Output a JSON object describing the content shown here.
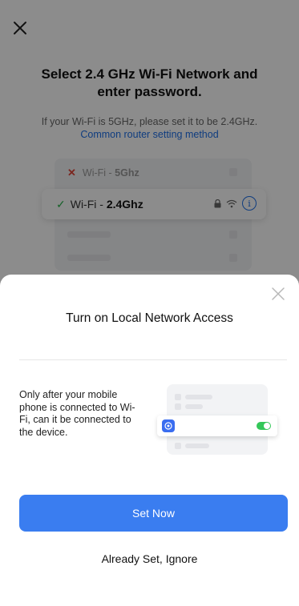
{
  "background": {
    "title": "Select 2.4 GHz Wi-Fi Network and enter password.",
    "hint": "If your Wi-Fi is 5GHz, please set it to be 2.4GHz.",
    "hint_link": "Common router setting method",
    "network_5g": {
      "prefix": "Wi-Fi - ",
      "band": "5Ghz",
      "status_icon": "x-icon"
    },
    "network_24g": {
      "prefix": "Wi-Fi - ",
      "band": "2.4Ghz",
      "status_icon": "check-icon",
      "info_symbol": "i"
    }
  },
  "sheet": {
    "title": "Turn on Local Network Access",
    "description": "Only after your mobile phone is connected to Wi-Fi, can it be connected to the device.",
    "primary_button": "Set Now",
    "secondary_link": "Already Set, Ignore"
  },
  "colors": {
    "accent": "#3a7df0",
    "link": "#1e6fe8",
    "success": "#2bb24c",
    "error": "#e0453a",
    "toggle_on": "#34c759"
  }
}
